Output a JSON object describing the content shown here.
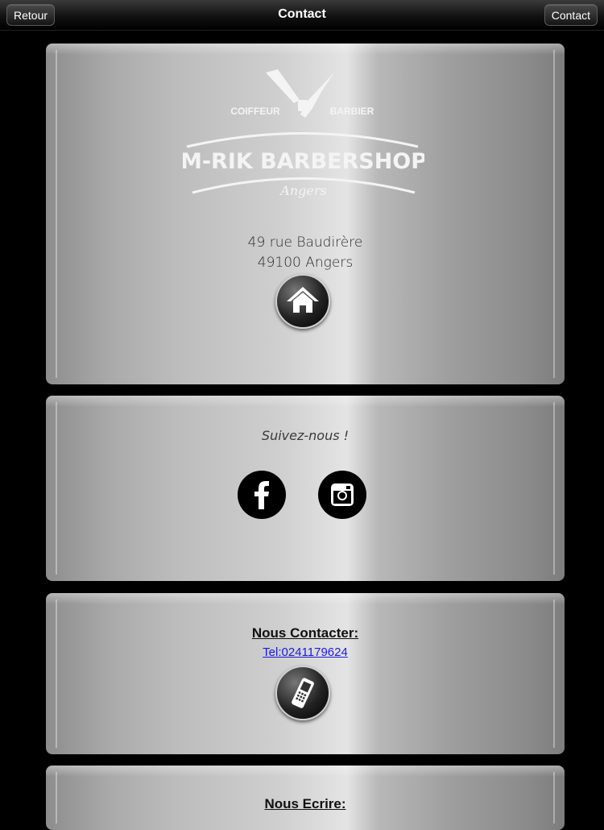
{
  "navbar": {
    "title": "Contact",
    "back_label": "Retour",
    "right_label": "Contact"
  },
  "logo": {
    "top_left": "COIFFEUR",
    "top_right": "BARBIER",
    "name": "M-RIK BARBERSHOP",
    "city": "Angers",
    "icon": "straight-razor-icon"
  },
  "address": {
    "line1": "49 rue Baudirère",
    "line2": "49100 Angers",
    "icon": "home-icon"
  },
  "social": {
    "heading": "Suivez-nous !",
    "facebook_icon": "facebook-icon",
    "instagram_icon": "instagram-icon"
  },
  "contact": {
    "heading": "Nous Contacter:",
    "phone_link": "Tel:0241179624",
    "icon": "mobile-phone-icon"
  },
  "write": {
    "heading": "Nous Ecrire:"
  },
  "colors": {
    "background": "#000000",
    "link": "#1a1ae6",
    "card_metal": "#c4c4c4"
  }
}
